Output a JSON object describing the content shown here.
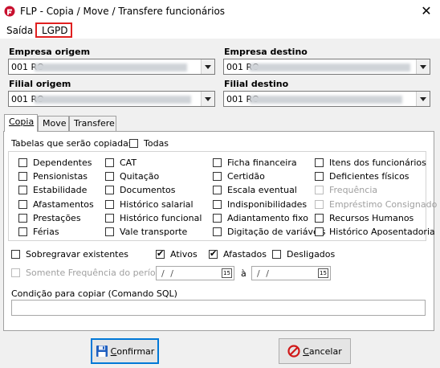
{
  "window": {
    "title": "FLP - Copia / Move / Transfere funcionários",
    "close_glyph": "✕",
    "icon": "flp-logo-icon",
    "accent_color": "#e02020"
  },
  "menu": {
    "items": [
      "Saída",
      "LGPD"
    ],
    "highlight_color": "#e02020"
  },
  "fields": {
    "empresa_origem": {
      "label": "Empresa origem",
      "value": "001 RO"
    },
    "empresa_destino": {
      "label": "Empresa destino",
      "value": "001 RO"
    },
    "filial_origem": {
      "label": "Filial origem",
      "value": "001 RO"
    },
    "filial_destino": {
      "label": "Filial destino",
      "value": "001 RO"
    }
  },
  "tabs": [
    {
      "label": "Copia",
      "active": true
    },
    {
      "label": "Move",
      "active": false
    },
    {
      "label": "Transfere",
      "active": false
    }
  ],
  "copy_tab": {
    "tables_label": "Tabelas que serão copiadas:",
    "todas_label": "Todas",
    "todas_checked": false,
    "columns": [
      [
        "Dependentes",
        "Pensionistas",
        "Estabilidade",
        "Afastamentos",
        "Prestações",
        "Férias"
      ],
      [
        "CAT",
        "Quitação",
        "Documentos",
        "Histórico salarial",
        "Histórico funcional",
        "Vale transporte"
      ],
      [
        "Ficha financeira",
        "Certidão",
        "Escala eventual",
        "Indisponibilidades",
        "Adiantamento fixo",
        "Digitação de variáveis"
      ],
      [
        "Itens dos funcionários",
        "Deficientes físicos",
        "Frequência",
        "Empréstimo Consignado",
        "Recursos Humanos",
        "Histórico Aposentadoria"
      ]
    ],
    "disabled_items": [
      "Frequência",
      "Empréstimo Consignado"
    ],
    "sobregravar": {
      "label": "Sobregravar existentes",
      "checked": false
    },
    "ativos": {
      "label": "Ativos",
      "checked": true
    },
    "afastados": {
      "label": "Afastados",
      "checked": true
    },
    "desligados": {
      "label": "Desligados",
      "checked": false
    },
    "frequencia_periodo": {
      "label": "Somente Frequência do período:",
      "checked": false,
      "from": "/ /",
      "to": "/ /",
      "separator": "à",
      "calendar_day": "15"
    },
    "sql_label": "Condição para copiar (Comando SQL)",
    "sql_value": ""
  },
  "buttons": {
    "confirmar": {
      "label": "Confirmar",
      "icon": "floppy-disk-icon"
    },
    "cancelar": {
      "label": "Cancelar",
      "icon": "cancel-circle-icon"
    }
  }
}
